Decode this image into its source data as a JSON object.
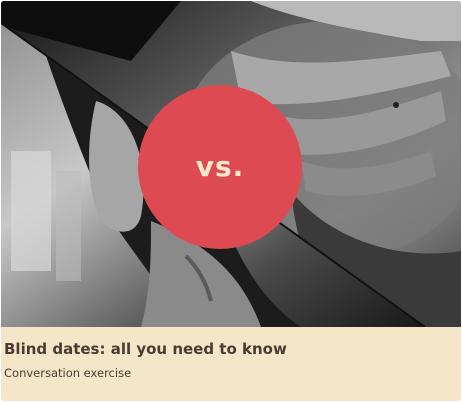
{
  "card": {
    "badge_text": "vs.",
    "title": "Blind dates: all you need to know",
    "subtitle": "Conversation exercise",
    "colors": {
      "badge": "#de4a52",
      "badge_text": "#f8e9cd",
      "caption_background": "#f6e6c9",
      "caption_text": "#4b3a33"
    }
  }
}
